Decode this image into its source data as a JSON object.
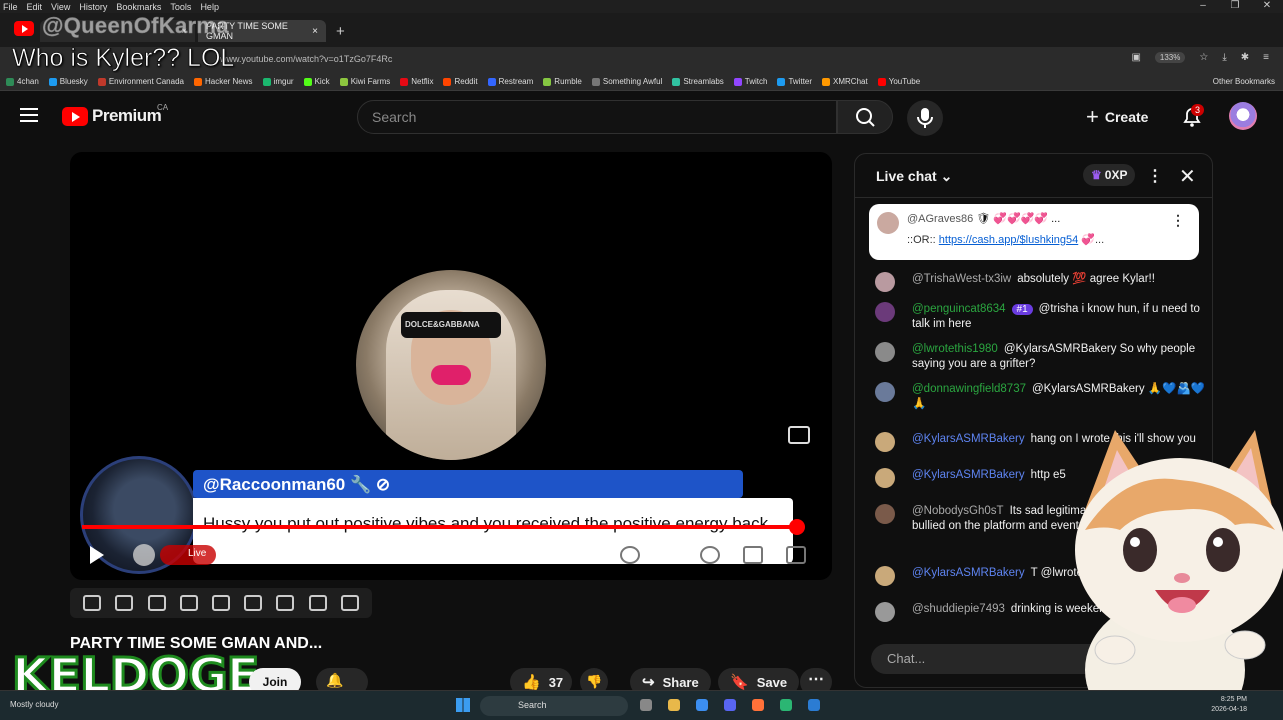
{
  "browser": {
    "menu": [
      "File",
      "Edit",
      "View",
      "History",
      "Bookmarks",
      "Tools",
      "Help"
    ],
    "tab1_title": "",
    "tab2_title": "PARTY TIME SOME GMAN",
    "url": "www.youtube.com/watch?v=o1TzGo7F4Rc",
    "zoom": "133%",
    "bookmarks": [
      "4chan",
      "Bluesky",
      "Environment Canada",
      "Hacker News",
      "imgur",
      "Kick",
      "Kiwi Farms",
      "Netflix",
      "Reddit",
      "Restream",
      "Rumble",
      "Something Awful",
      "Streamlabs",
      "Twitch",
      "Twitter",
      "XMRChat",
      "YouTube"
    ],
    "bookmark_colors": [
      "#2e8b57",
      "#1d9bf0",
      "#c0392b",
      "#ff6600",
      "#1bb76e",
      "#53fc18",
      "#8dc63f",
      "#e50914",
      "#ff4500",
      "#3366ff",
      "#85c742",
      "#777777",
      "#31c3a2",
      "#9146ff",
      "#1d9bf0",
      "#ff9900",
      "#ff0000"
    ],
    "other_bookmarks": "Other Bookmarks"
  },
  "overlay": {
    "handle": "@QueenOfKarma",
    "title": "Who is Kyler?? LOL",
    "brand": "KELDOGE"
  },
  "header": {
    "brand": "Premium",
    "region": "CA",
    "search_placeholder": "Search",
    "create_label": "Create",
    "notification_count": "3"
  },
  "player": {
    "banner_name": "@Raccoonman60",
    "banner_message": "Hussy you put out positive vibes and you received the positive energy back",
    "live_label": "Live",
    "progress_fraction": 0.97
  },
  "video": {
    "title": "PARTY TIME SOME GMAN AND...",
    "join_label": "Join",
    "likes": "37",
    "share_label": "Share",
    "save_label": "Save"
  },
  "chat": {
    "title": "Live chat",
    "xp": "0XP",
    "pinned": {
      "author": "@AGraves86",
      "line2_prefix": "::OR::",
      "link": "https://cash.app/$lushking54"
    },
    "messages": [
      {
        "author": "@TrishaWest-tx3iw",
        "text": "absolutely 💯 agree Kylar!!",
        "type": "normal",
        "color": "#b99aa0"
      },
      {
        "author": "@penguincat8634",
        "badge": "#1",
        "text": "@trisha i know hun, if u need to talk im here",
        "type": "mem",
        "color": "#6b3a7a"
      },
      {
        "author": "@lwrotethis1980",
        "text": "@KylarsASMRBakery So why people saying you are a grifter?",
        "type": "mem",
        "color": "#8a8a8a"
      },
      {
        "author": "@donnawingfield8737",
        "text": "@KylarsASMRBakery 🙏💙🫂💙🙏",
        "type": "mem",
        "color": "#6a7a9a"
      },
      {
        "author": "@KylarsASMRBakery",
        "text": "hang on I wrote this i'll show you",
        "type": "mod",
        "color": "#c9a97a"
      },
      {
        "author": "@KylarsASMRBakery",
        "text": "http e5",
        "type": "mod",
        "color": "#c9a97a"
      },
      {
        "author": "@NobodysGh0sT",
        "text": "Its sad legitimately on hard times bullied on the platform and eventually feel they can't as",
        "type": "normal",
        "color": "#7a5a4a"
      },
      {
        "author": "@KylarsASMRBakery",
        "text": "T @lwrotethis1980",
        "type": "mod",
        "color": "#c9a97a"
      },
      {
        "author": "@shuddiepie7493",
        "text": "drinking is weekends",
        "type": "normal",
        "color": "#999999"
      }
    ],
    "input_placeholder": "Chat..."
  },
  "taskbar": {
    "weather": "Mostly cloudy",
    "search": "Search",
    "time": "8:25 PM",
    "date": "2026-04-18"
  }
}
